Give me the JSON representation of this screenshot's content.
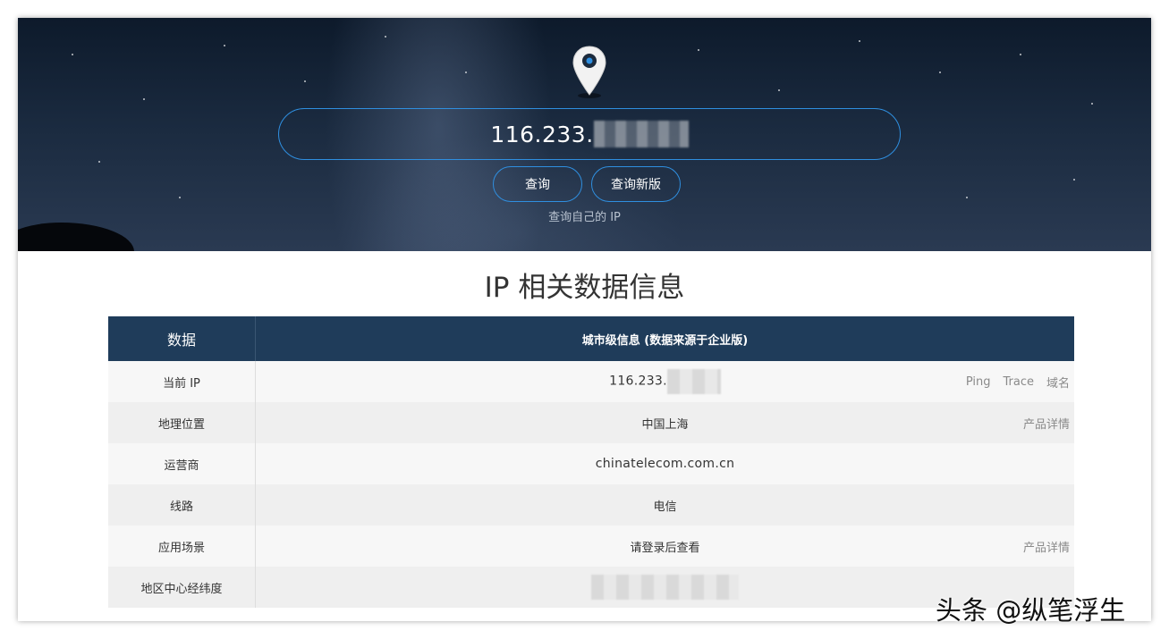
{
  "search": {
    "ip_visible": "116.233."
  },
  "buttons": {
    "query": "查询",
    "query_new": "查询新版"
  },
  "self_ip_link": "查询自己的 IP",
  "section_title": "IP 相关数据信息",
  "table": {
    "headers": [
      "数据",
      "城市级信息 (数据来源于企业版)"
    ],
    "rows": [
      {
        "label": "当前 IP",
        "value": "116.233.",
        "links": [
          "Ping",
          "Trace",
          "域名"
        ]
      },
      {
        "label": "地理位置",
        "value": "中国上海",
        "links": [
          "产品详情"
        ]
      },
      {
        "label": "运营商",
        "value": "chinatelecom.com.cn",
        "links": []
      },
      {
        "label": "线路",
        "value": "电信",
        "links": []
      },
      {
        "label": "应用场景",
        "value": "请登录后查看",
        "links": [
          "产品详情"
        ]
      },
      {
        "label": "地区中心经纬度",
        "value": "",
        "links": []
      }
    ]
  },
  "watermark": "头条 @纵笔浮生",
  "colors": {
    "accent": "#2f8fe0",
    "table_header": "#1f3c5a",
    "link_gray": "#8a8a8a"
  },
  "icons": [
    "location-pin-icon"
  ]
}
